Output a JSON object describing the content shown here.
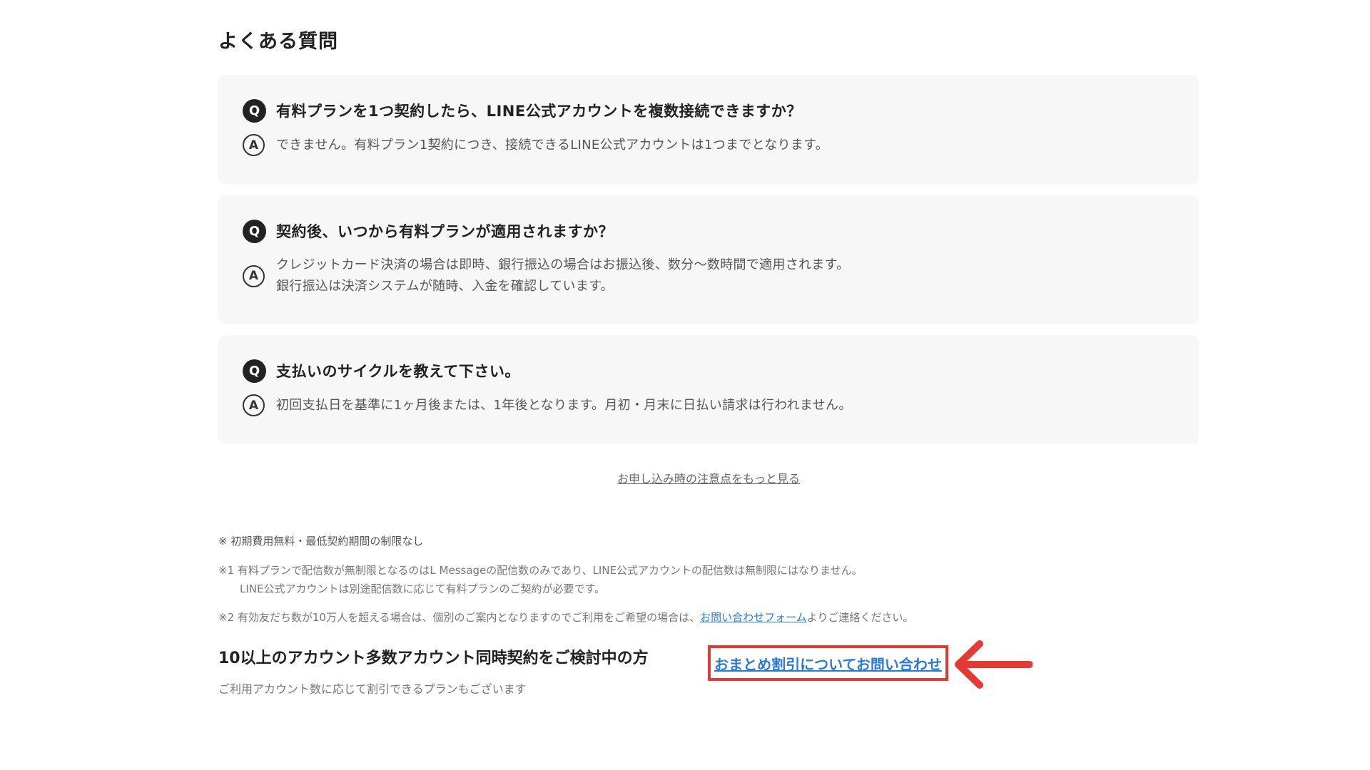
{
  "faq": {
    "title": "よくある質問",
    "q_icon": "Q",
    "a_icon": "A",
    "items": [
      {
        "question": "有料プランを1つ契約したら、LINE公式アカウントを複数接続できますか？",
        "answer_lines": [
          "できません。有料プラン1契約につき、接続できるLINE公式アカウントは1つまでとなります。"
        ]
      },
      {
        "question": "契約後、いつから有料プランが適用されますか？",
        "answer_lines": [
          "クレジットカード決済の場合は即時、銀行振込の場合はお振込後、数分〜数時間で適用されます。",
          "銀行振込は決済システムが随時、入金を確認しています。"
        ]
      },
      {
        "question": "支払いのサイクルを教えて下さい。",
        "answer_lines": [
          "初回支払日を基準に1ヶ月後または、1年後となります。月初・月末に日払い請求は行われません。"
        ]
      }
    ],
    "more_link": "お申し込み時の注意点をもっと見る"
  },
  "notes": {
    "lead": "※ 初期費用無料・最低契約期間の制限なし",
    "note1_line1": "※1 有料プランで配信数が無制限となるのはL Messageの配信数のみであり、LINE公式アカウントの配信数は無制限にはなりません。",
    "note1_line2": "LINE公式アカウントは別途配信数に応じて有料プランのご契約が必要です。",
    "note2_before": "※2 有効友だち数が10万人を超える場合は、個別のご案内となりますのでご利用をご希望の場合は、",
    "note2_link": "お問い合わせフォーム",
    "note2_after": "よりご連絡ください。"
  },
  "bottom": {
    "title": "10以上のアカウント多数アカウント同時契約をご検討中の方",
    "subtitle": "ご利用アカウント数に応じて割引できるプランもございます",
    "discount_link": "おまとめ割引についてお問い合わせ"
  },
  "colors": {
    "highlight": "#e53935",
    "link": "#2a7ad5",
    "card_bg": "#f7f7f7"
  },
  "icons": {
    "arrow": "left-arrow-icon"
  }
}
